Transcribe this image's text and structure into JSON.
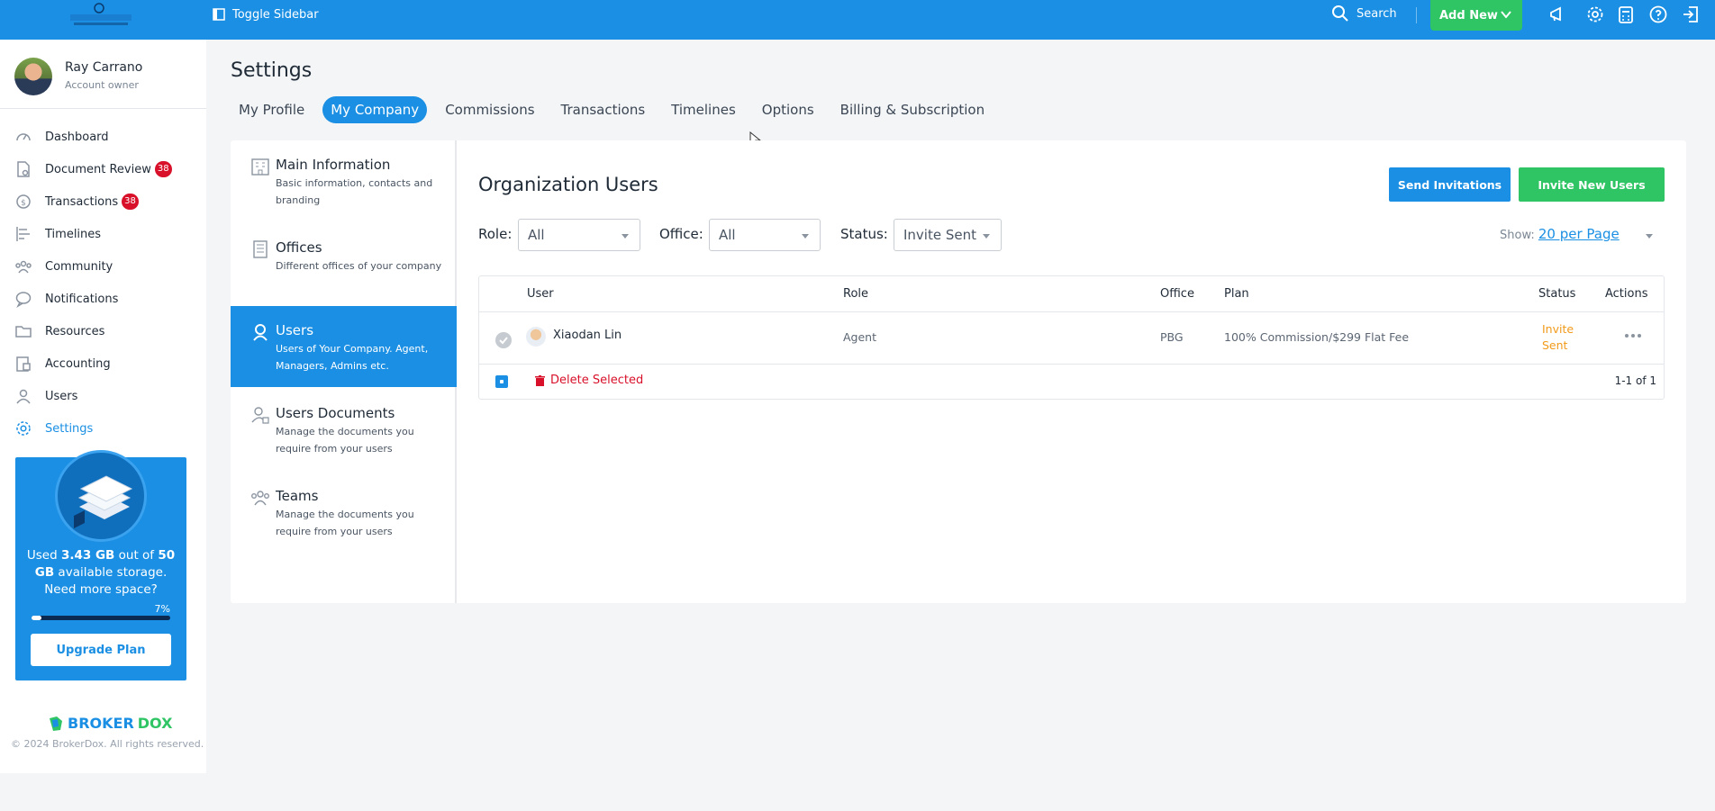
{
  "colors": {
    "primary": "#1a8fe3",
    "success": "#2fc464",
    "danger": "#d8102a",
    "warning": "#f29a1a"
  },
  "topbar": {
    "toggle_label": "Toggle Sidebar",
    "search_label": "Search",
    "add_new_label": "Add New",
    "icons": [
      "megaphone-icon",
      "gear-icon",
      "calculator-icon",
      "help-icon",
      "logout-icon"
    ]
  },
  "profile": {
    "name": "Ray Carrano",
    "role": "Account owner"
  },
  "sidebar": {
    "items": [
      {
        "label": "Dashboard",
        "icon": "dashboard-icon"
      },
      {
        "label": "Document Review",
        "icon": "document-review-icon",
        "badge": "38"
      },
      {
        "label": "Transactions",
        "icon": "transactions-icon",
        "badge": "38"
      },
      {
        "label": "Timelines",
        "icon": "timelines-icon"
      },
      {
        "label": "Community",
        "icon": "community-icon"
      },
      {
        "label": "Notifications",
        "icon": "chat-icon"
      },
      {
        "label": "Resources",
        "icon": "folder-icon"
      },
      {
        "label": "Accounting",
        "icon": "accounting-icon"
      },
      {
        "label": "Users",
        "icon": "user-icon"
      },
      {
        "label": "Settings",
        "icon": "gear-icon",
        "active": true
      }
    ]
  },
  "storage": {
    "used_prefix": "Used ",
    "used": "3.43 GB",
    "out_of": " out of ",
    "total": "50 GB",
    "available": " available storage. Need more space?",
    "percent_label": "7%",
    "percent": 0.07,
    "upgrade_label": "Upgrade Plan"
  },
  "footer": {
    "brand_part1": "BROKER",
    "brand_part2": "DOX",
    "copyright": "© 2024 BrokerDox. All rights reserved."
  },
  "page": {
    "title": "Settings",
    "tabs": [
      "My Profile",
      "My Company",
      "Commissions",
      "Transactions",
      "Timelines",
      "Options",
      "Billing & Subscription"
    ],
    "active_tab": "My Company"
  },
  "subnav": [
    {
      "title": "Main Information",
      "desc": "Basic information, contacts and branding",
      "icon": "building-icon"
    },
    {
      "title": "Offices",
      "desc": "Different offices of your company",
      "icon": "office-building-icon"
    },
    {
      "title": "Users",
      "desc": "Users of Your Company. Agent, Managers, Admins etc.",
      "icon": "user-badge-icon",
      "active": true
    },
    {
      "title": "Users Documents",
      "desc": "Manage the documents you require from your users",
      "icon": "user-document-icon"
    },
    {
      "title": "Teams",
      "desc": "Manage the documents you require from your users",
      "icon": "team-icon"
    }
  ],
  "org": {
    "title": "Organization Users",
    "send_invitations": "Send Invitations",
    "invite_new": "Invite New Users",
    "filters": {
      "role_label": "Role:",
      "role_value": "All",
      "office_label": "Office:",
      "office_value": "All",
      "status_label": "Status:",
      "status_value": "Invite Sent"
    },
    "show_label": "Show:",
    "show_value": "20 per Page",
    "columns": [
      "User",
      "Role",
      "Office",
      "Plan",
      "Status",
      "Actions"
    ],
    "rows": [
      {
        "user": "Xiaodan Lin",
        "role": "Agent",
        "office": "PBG",
        "plan": "100% Commission/$299 Flat Fee",
        "status": "Invite Sent"
      }
    ],
    "delete_selected": "Delete Selected",
    "range": "1-1 of 1"
  }
}
